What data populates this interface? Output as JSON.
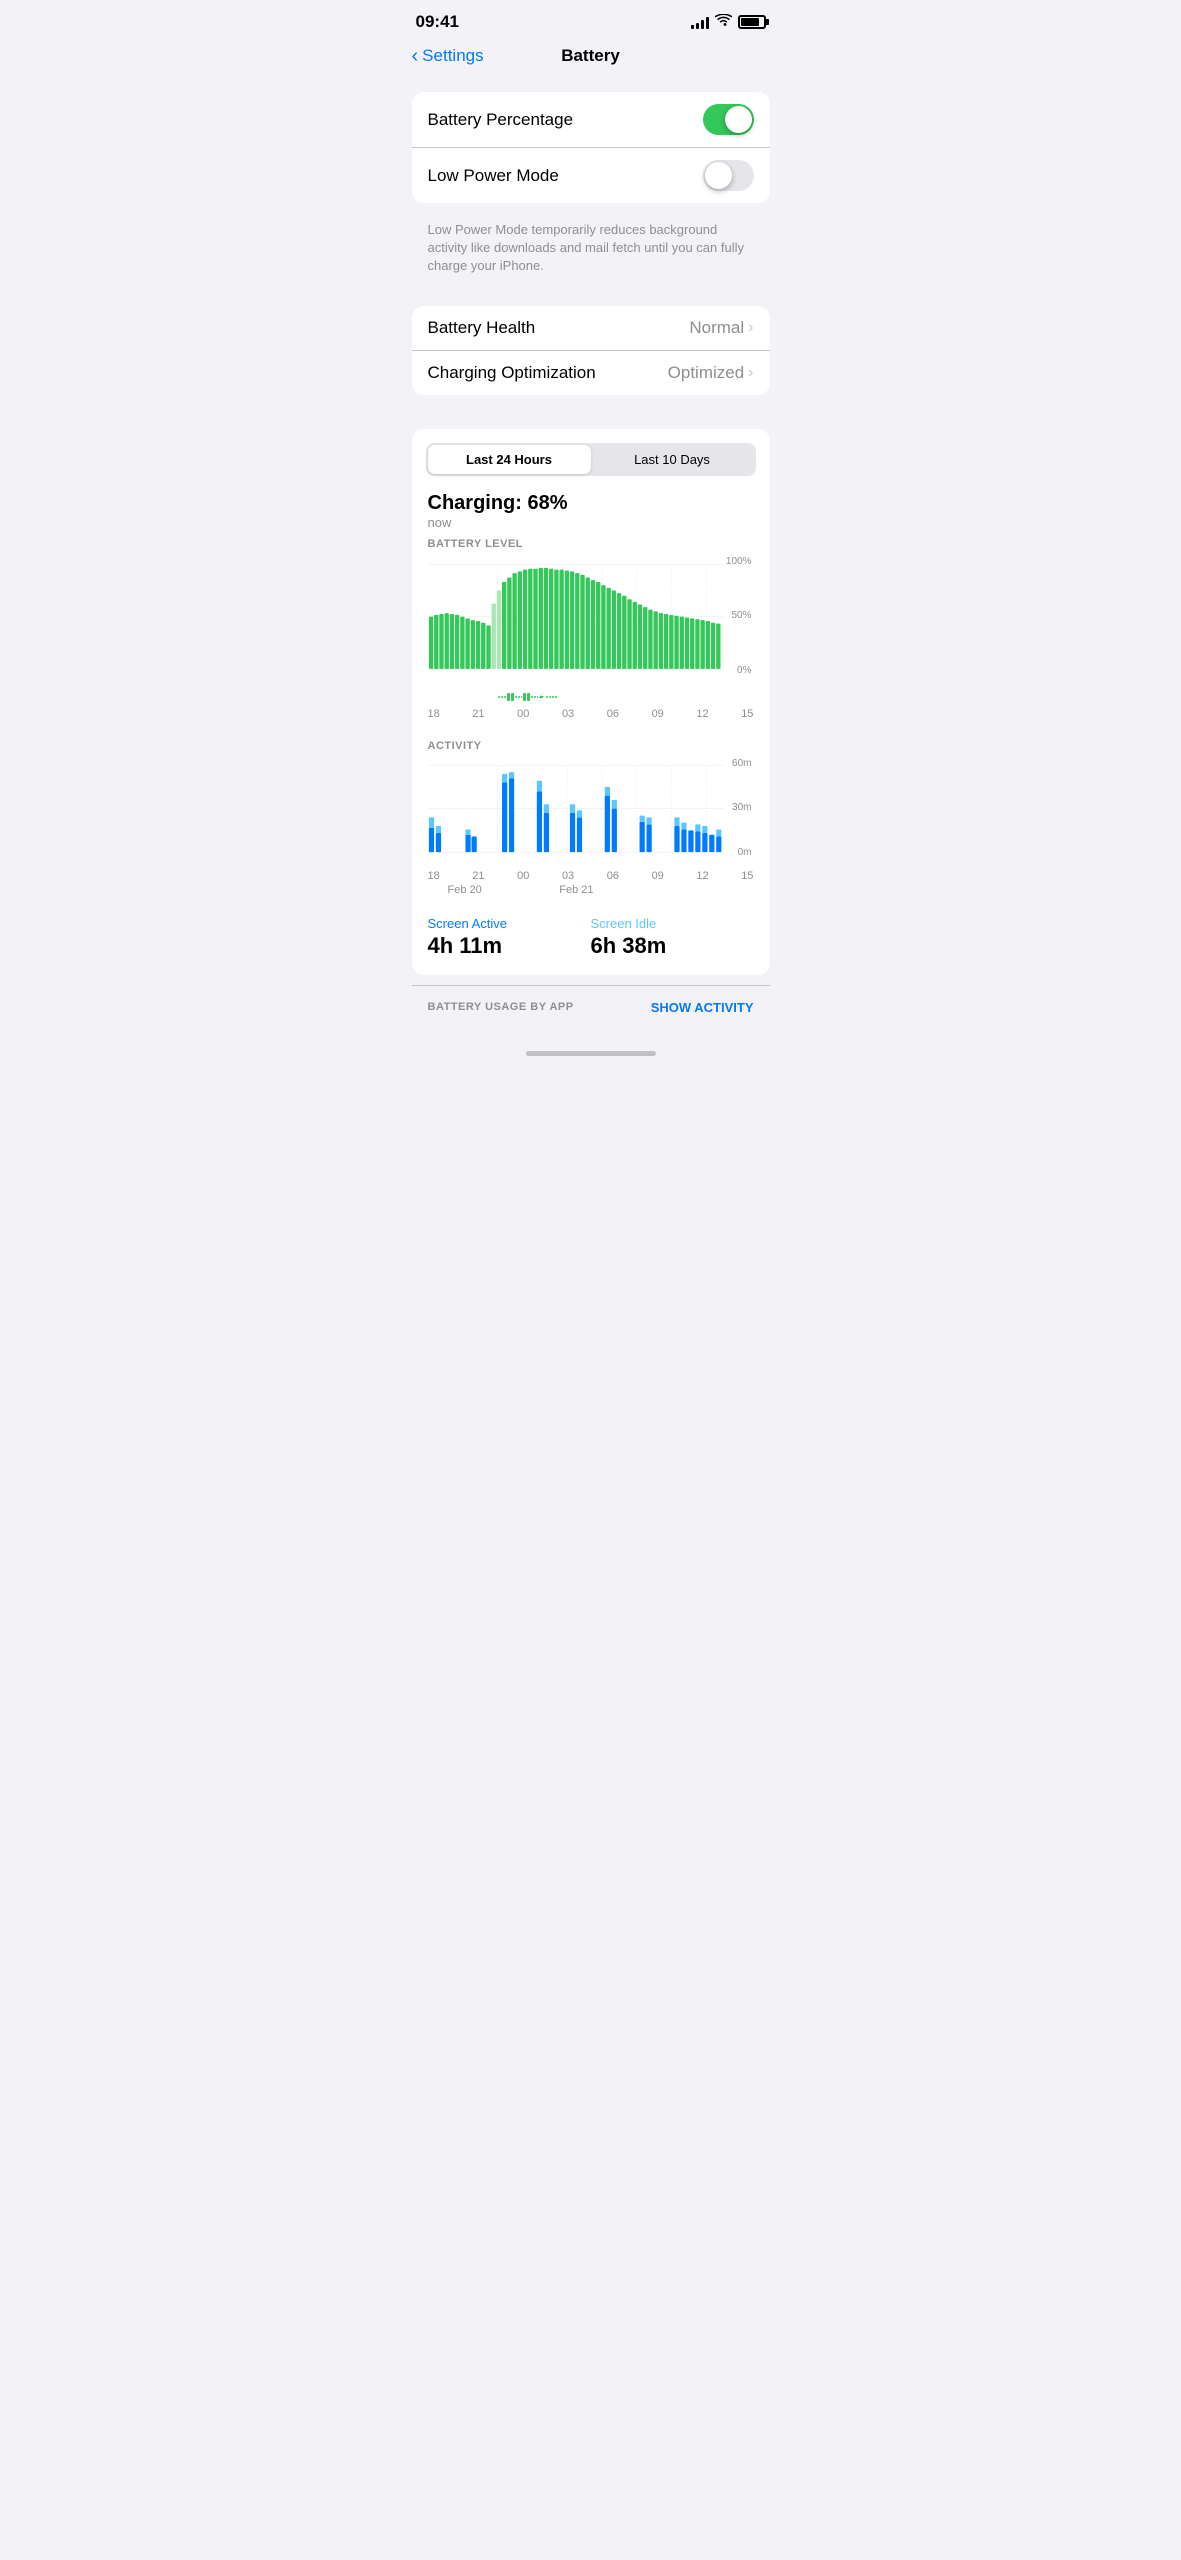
{
  "statusBar": {
    "time": "09:41",
    "battery_level": 85
  },
  "header": {
    "back_label": "Settings",
    "title": "Battery"
  },
  "settings": {
    "battery_percentage": {
      "label": "Battery Percentage",
      "enabled": true
    },
    "low_power_mode": {
      "label": "Low Power Mode",
      "enabled": false
    },
    "low_power_description": "Low Power Mode temporarily reduces background activity like downloads and mail fetch until you can fully charge your iPhone."
  },
  "health": {
    "battery_health_label": "Battery Health",
    "battery_health_value": "Normal",
    "charging_optimization_label": "Charging Optimization",
    "charging_optimization_value": "Optimized"
  },
  "chart": {
    "segment_active": "Last 24 Hours",
    "segment_inactive": "Last 10 Days",
    "charging_label": "Charging: 68%",
    "charging_sub": "now",
    "battery_section_title": "BATTERY LEVEL",
    "activity_section_title": "ACTIVITY",
    "time_labels": [
      "18",
      "21",
      "00",
      "03",
      "06",
      "09",
      "12",
      "15"
    ],
    "y_labels_battery": [
      "100%",
      "50%",
      "0%"
    ],
    "y_labels_activity": [
      "60m",
      "30m",
      "0m"
    ],
    "date_labels": [
      "Feb 20",
      "Feb 21"
    ],
    "screen_active_label": "Screen Active",
    "screen_active_value": "4h 11m",
    "screen_idle_label": "Screen Idle",
    "screen_idle_value": "6h 38m"
  },
  "footer": {
    "battery_usage_label": "BATTERY USAGE BY APP",
    "show_activity_label": "SHOW ACTIVITY"
  }
}
